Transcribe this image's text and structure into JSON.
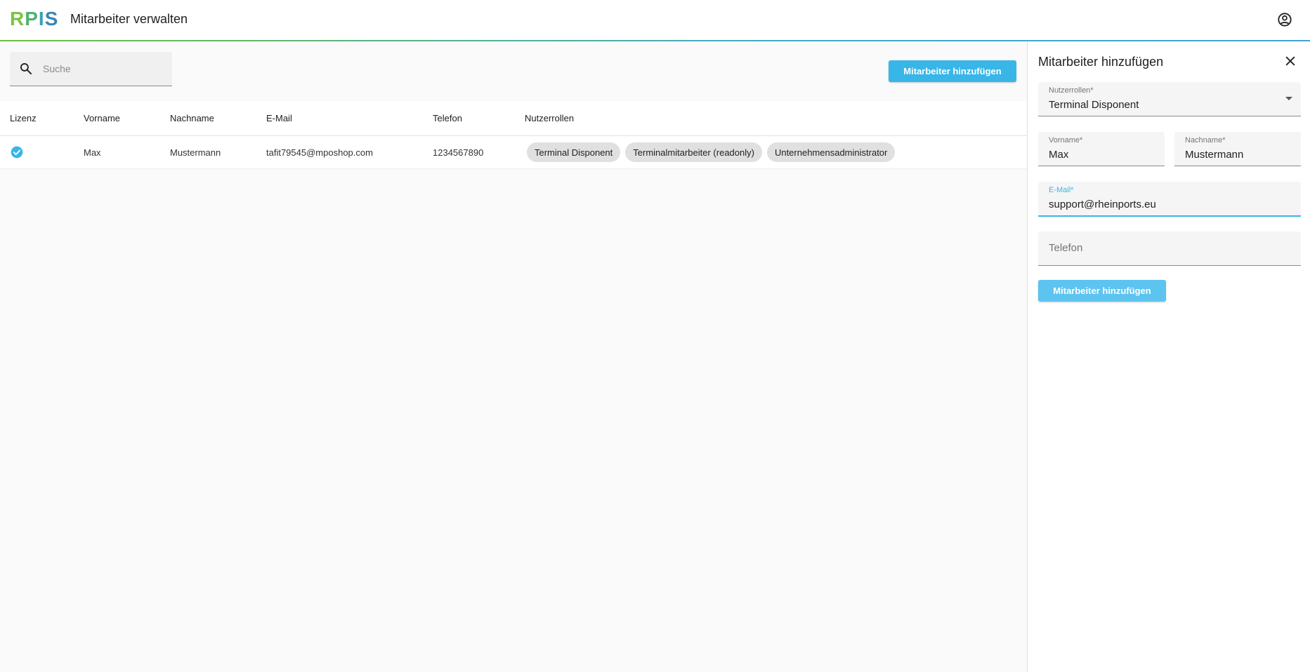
{
  "header": {
    "logo_letters": [
      "R",
      "P",
      "I",
      "S"
    ],
    "title": "Mitarbeiter verwalten",
    "account_icon": "account-circle-icon"
  },
  "main": {
    "search": {
      "placeholder": "Suche",
      "value": ""
    },
    "add_button_label": "Mitarbeiter hinzufügen",
    "table": {
      "headers": [
        "Lizenz",
        "Vorname",
        "Nachname",
        "E-Mail",
        "Telefon",
        "Nutzerrollen"
      ],
      "rows": [
        {
          "lizenz": "check-circle-icon",
          "vorname": "Max",
          "nachname": "Mustermann",
          "email": "tafit79545@mposhop.com",
          "telefon": "1234567890",
          "rollen": [
            "Terminal Disponent",
            "Terminalmitarbeiter (readonly)",
            "Unternehmensadministrator"
          ]
        }
      ]
    }
  },
  "drawer": {
    "title": "Mitarbeiter hinzufügen",
    "close_icon": "close-icon",
    "fields": {
      "nutzerrollen": {
        "label": "Nutzerrollen*",
        "value": "Terminal Disponent"
      },
      "vorname": {
        "label": "Vorname*",
        "value": "Max"
      },
      "nachname": {
        "label": "Nachname*",
        "value": "Mustermann"
      },
      "email": {
        "label": "E-Mail*",
        "value": "support@rheinports.eu"
      },
      "telefon": {
        "placeholder": "Telefon",
        "value": ""
      }
    },
    "submit_label": "Mitarbeiter hinzufügen"
  },
  "colors": {
    "accent": "#38b6e8",
    "logo_green": "#7cc242",
    "logo_blue": "#3a86b4"
  }
}
